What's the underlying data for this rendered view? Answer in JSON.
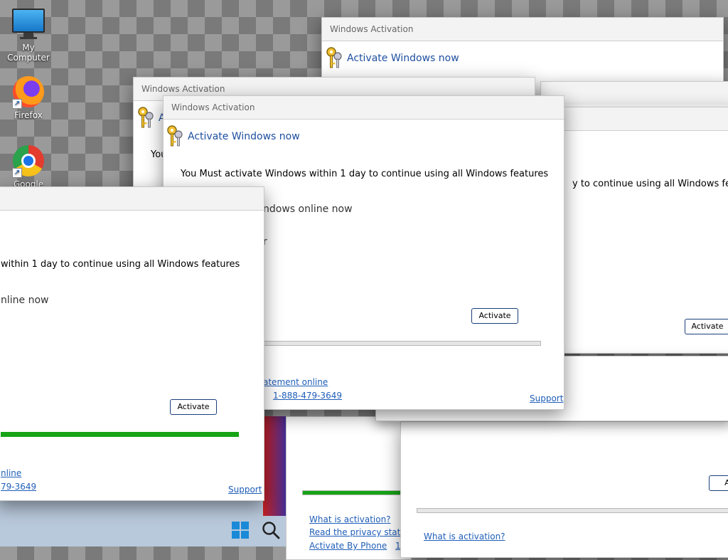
{
  "desktop": {
    "icons": [
      {
        "label": "My Computer",
        "icon": "monitor-icon"
      },
      {
        "label": "Firefox",
        "icon": "firefox-icon"
      },
      {
        "label": "Google",
        "icon": "chrome-icon"
      }
    ]
  },
  "dialog": {
    "title": "Windows Activation",
    "heading": "Activate Windows now",
    "message": "You Must activate Windows within 1 day to continue using all Windows features",
    "option_online": "Activate Windows online now",
    "button_activate": "Activate",
    "link_what": "What is activation?",
    "link_privacy": "Read the privacy statement online",
    "link_phone": "Activate By Phone",
    "phone": "1-888-479-3649",
    "link_support": "Support"
  },
  "fragments": {
    "you": "You",
    "a_head": "A",
    "y_day": "y to continue using all Windows featu",
    "ndows_online": "ndows online now",
    "r_frag": "r",
    "atement_online": "atement online",
    "within_day": " within 1 day to continue using all Windows features",
    "nline_now": "nline now",
    "nline": "nline",
    "phone_tail": "79-3649",
    "act": "Act",
    "read_privacy_cut": "Read the privacy statem",
    "activate_by_phone_cut": "Activate By Phone",
    "one_cut": "1"
  },
  "progress": {
    "front_right_fill": 0,
    "front_left_fill": 1.0,
    "bottom_mid_fill": 1.0,
    "bottom_right_fill": 0
  },
  "taskbar": {
    "icons": [
      "windows-start-icon",
      "search-icon"
    ]
  },
  "colors": {
    "accent_link": "#1f5eb8",
    "heading_blue": "#1e4fa0",
    "progress_green": "#16a316"
  }
}
